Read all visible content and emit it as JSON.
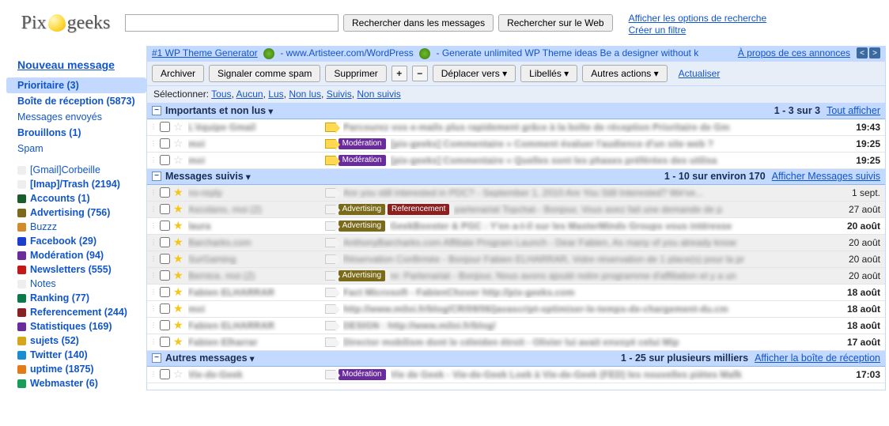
{
  "search": {
    "placeholder": "",
    "value": "",
    "btn_messages": "Rechercher dans les messages",
    "btn_web": "Rechercher sur le Web",
    "show_options": "Afficher les options de recherche",
    "create_filter": "Créer un filtre"
  },
  "sidebar": {
    "compose": "Nouveau message",
    "main": [
      {
        "label": "Prioritaire (3)",
        "sel": true,
        "bold": true
      },
      {
        "label": "Boîte de réception (5873)",
        "bold": true
      },
      {
        "label": "Messages envoyés"
      },
      {
        "label": "Brouillons (1)",
        "bold": true
      },
      {
        "label": "Spam"
      }
    ],
    "labels": [
      {
        "label": "[Gmail]Corbeille",
        "color": "#eeeeee"
      },
      {
        "label": "[Imap]/Trash (2194)",
        "color": "#eeeeee",
        "bold": true
      },
      {
        "label": "Accounts (1)",
        "color": "#1a5c2a",
        "bold": true
      },
      {
        "label": "Advertising (756)",
        "color": "#7a6a1a",
        "bold": true
      },
      {
        "label": "Buzzz",
        "color": "#d08c2a"
      },
      {
        "label": "Facebook (29)",
        "color": "#1a3fd0",
        "bold": true
      },
      {
        "label": "Modération (94)",
        "color": "#6a2c9c",
        "bold": true
      },
      {
        "label": "Newsletters (555)",
        "color": "#c21818",
        "bold": true
      },
      {
        "label": "Notes",
        "color": "#eeeeee"
      },
      {
        "label": "Ranking (77)",
        "color": "#0a7a4a",
        "bold": true
      },
      {
        "label": "Referencement (244)",
        "color": "#8a2020",
        "bold": true
      },
      {
        "label": "Statistiques (169)",
        "color": "#6a2c9c",
        "bold": true
      },
      {
        "label": "sujets (52)",
        "color": "#d6a618",
        "bold": true
      },
      {
        "label": "Twitter (140)",
        "color": "#1a8cd0",
        "bold": true
      },
      {
        "label": "uptime (1875)",
        "color": "#e47a18",
        "bold": true
      },
      {
        "label": "Webmaster (6)",
        "color": "#1a9c5a",
        "bold": true
      }
    ]
  },
  "ad": {
    "text1": "#1 WP Theme Generator",
    "text2": " - www.Artisteer.com/WordPress",
    "text3": " - Generate unlimited WP Theme ideas Be a designer without k",
    "about": "À propos de ces annonces"
  },
  "toolbar": {
    "archive": "Archiver",
    "spam": "Signaler comme spam",
    "delete": "Supprimer",
    "move": "Déplacer vers ▾",
    "labels": "Libellés ▾",
    "more": "Autres actions ▾",
    "refresh": "Actualiser",
    "select_label": "Sélectionner:",
    "select_opts": [
      "Tous",
      "Aucun",
      "Lus",
      "Non lus",
      "Suivis",
      "Non suivis"
    ]
  },
  "sections": [
    {
      "title": "Importants et non lus",
      "count": "1 - 3 sur 3",
      "link": "Tout afficher",
      "rows": [
        {
          "bold": true,
          "bg": "white",
          "star": false,
          "imp": "on",
          "tags": [],
          "sender": "L'équipe Gmail",
          "subject": "Parcourez vos e-mails plus rapidement grâce à la boîte de réception Prioritaire de Gm",
          "date": "19:43"
        },
        {
          "bold": true,
          "bg": "white",
          "star": false,
          "imp": "on",
          "tags": [
            {
              "t": "Modération",
              "c": "#6a2c9c"
            }
          ],
          "sender": "moi",
          "subject": "[pix-geeks] Commentaire « Comment évaluer l'audience d'un site web ?",
          "date": "19:25"
        },
        {
          "bold": true,
          "bg": "white",
          "star": false,
          "imp": "on",
          "tags": [
            {
              "t": "Modération",
              "c": "#6a2c9c"
            }
          ],
          "sender": "moi",
          "subject": "[pix-geeks] Commentaire « Quelles sont les phases préférées des utilisa",
          "date": "19:25"
        }
      ]
    },
    {
      "title": "Messages suivis",
      "count": "1 - 10 sur environ 170",
      "link": "Afficher Messages suivis",
      "rows": [
        {
          "bold": false,
          "bg": "gray",
          "star": true,
          "imp": "off",
          "tags": [],
          "sender": "no-reply",
          "subject": "Are you still interested in PDC? - September 1, 2010 Are You Still Interested? We've...",
          "date": "1 sept."
        },
        {
          "bold": false,
          "bg": "gray",
          "star": true,
          "imp": "off",
          "tags": [
            {
              "t": "Advertising",
              "c": "#7a6a1a"
            },
            {
              "t": "Referencement",
              "c": "#8a2020"
            }
          ],
          "sender": "Ascolano, moi (2)",
          "subject": "partenariat Topchat - Bonjour, Vous avez fait une demande de p",
          "date": "27 août"
        },
        {
          "bold": true,
          "bg": "white",
          "star": true,
          "imp": "off",
          "tags": [
            {
              "t": "Advertising",
              "c": "#7a6a1a"
            }
          ],
          "sender": "laura",
          "subject": "GeekBooster & PGC : Y'en a-t-il sur les MasterMinds Groups vous intéresse",
          "date": "20 août"
        },
        {
          "bold": false,
          "bg": "gray",
          "star": true,
          "imp": "off",
          "tags": [],
          "sender": "Barcharks.com",
          "subject": "AnthonyBarcharks.com Affiliate Program Launch - Dear Fabien, As many of you already know",
          "date": "20 août"
        },
        {
          "bold": false,
          "bg": "gray",
          "star": true,
          "imp": "off",
          "tags": [],
          "sender": "SurGaming",
          "subject": "Réservation Confirmée - Bonjour Fabien ELHARRAR, Votre réservation de 1 place(s) pour la pr",
          "date": "20 août"
        },
        {
          "bold": false,
          "bg": "gray",
          "star": true,
          "imp": "off",
          "tags": [
            {
              "t": "Advertising",
              "c": "#7a6a1a"
            }
          ],
          "sender": "Bernice, moi (2)",
          "subject": "re: Partenariat - Bonjour, Nous avons ajouté notre programme d'affiliation et y a un",
          "date": "20 août"
        },
        {
          "bold": true,
          "bg": "white",
          "star": true,
          "imp": "off",
          "tags": [],
          "sender": "Fabien ELHARRAR",
          "subject": "Fact Microsoft - FabienChover http://pix-geeks.com",
          "date": "18 août"
        },
        {
          "bold": true,
          "bg": "white",
          "star": true,
          "imp": "off",
          "tags": [],
          "sender": "moi",
          "subject": "http://www.miloi.fr/blog/CR/09/06/javascript-optimiser-le-temps-de-chargement-du.cm",
          "date": "18 août"
        },
        {
          "bold": true,
          "bg": "white",
          "star": true,
          "imp": "off",
          "tags": [],
          "sender": "Fabien ELHARRAR",
          "subject": "DESIGN : http://www.miloi.fr/blog/",
          "date": "18 août"
        },
        {
          "bold": true,
          "bg": "white",
          "star": true,
          "imp": "off",
          "tags": [],
          "sender": "Fabien Elharrar",
          "subject": "Director mobilism dont le céleiden étroit - Olivier lui avait envoyé celui Mip",
          "date": "17 août"
        }
      ]
    },
    {
      "title": "Autres messages",
      "count": "1 - 25 sur plusieurs milliers",
      "link": "Afficher la boîte de réception",
      "rows": [
        {
          "bold": true,
          "bg": "white",
          "star": false,
          "imp": "off",
          "tags": [
            {
              "t": "Modération",
              "c": "#6a2c9c"
            }
          ],
          "sender": "Vie-de-Geek",
          "subject": "Vie de Geek - Vie-de-Geek Loek à Vie-de-Geek (FED) les nouvelles piètes Mafk",
          "date": "17:03"
        }
      ]
    }
  ]
}
